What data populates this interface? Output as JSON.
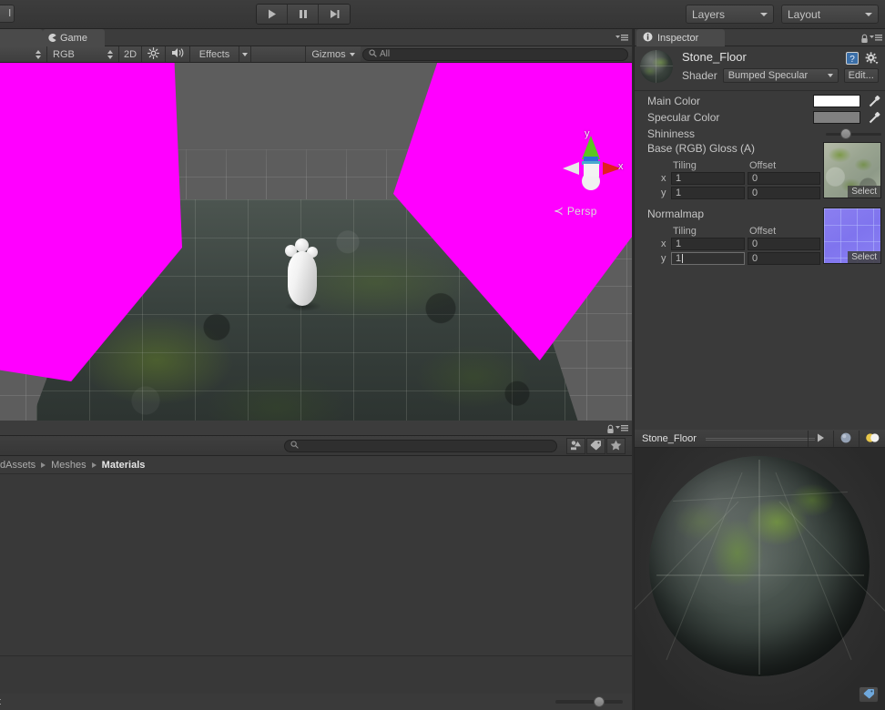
{
  "toolbar": {
    "left_button_label": "l",
    "play_controls": [
      {
        "name": "play",
        "icon": "play-icon"
      },
      {
        "name": "pause",
        "icon": "pause-icon"
      },
      {
        "name": "step",
        "icon": "step-icon"
      }
    ],
    "layers_label": "Layers",
    "layout_label": "Layout"
  },
  "game_view": {
    "tab_label": "Game",
    "toolbar": {
      "aspect_label": "",
      "color_mode": "RGB",
      "mode_2d": "2D",
      "lighting_icon": "sun-icon",
      "audio_icon": "mute-audio-icon",
      "effects_label": "Effects",
      "gizmos_label": "Gizmos",
      "search_placeholder": "All",
      "search_value": "All"
    },
    "gizmo": {
      "axis_y": "y",
      "axis_x": "x",
      "projection_label": "Persp"
    }
  },
  "project_view": {
    "search_value": "",
    "breadcrumb": [
      {
        "label": "dAssets",
        "current": false
      },
      {
        "label": "Meshes",
        "current": false
      },
      {
        "label": "Materials",
        "current": true
      }
    ],
    "footer_text": "t",
    "zoom_value": 55
  },
  "inspector": {
    "tab_label": "Inspector",
    "material_name": "Stone_Floor",
    "shader_label": "Shader",
    "shader_value": "Bumped Specular",
    "edit_button": "Edit...",
    "properties": [
      {
        "label": "Main Color",
        "type": "color",
        "value": "#ffffff"
      },
      {
        "label": "Specular Color",
        "type": "color",
        "value": "#808080"
      },
      {
        "label": "Shininess",
        "type": "slider",
        "value": 28
      }
    ],
    "textures": [
      {
        "label": "Base (RGB) Gloss (A)",
        "tiling_header": "Tiling",
        "offset_header": "Offset",
        "rows": [
          {
            "axis": "x",
            "tiling": "1",
            "offset": "0"
          },
          {
            "axis": "y",
            "tiling": "1",
            "offset": "0"
          }
        ],
        "select_label": "Select",
        "preview": "stone-texture"
      },
      {
        "label": "Normalmap",
        "tiling_header": "Tiling",
        "offset_header": "Offset",
        "rows": [
          {
            "axis": "x",
            "tiling": "1",
            "offset": "0"
          },
          {
            "axis": "y",
            "tiling": "1",
            "offset": "0",
            "editing": true
          }
        ],
        "select_label": "Select",
        "preview": "normalmap-texture"
      }
    ]
  },
  "preview": {
    "title": "Stone_Floor",
    "buttons": [
      {
        "name": "play-preview",
        "icon": "play-icon"
      },
      {
        "name": "preview-mesh",
        "icon": "sphere-icon"
      },
      {
        "name": "preview-lighting",
        "icon": "lighting-icon"
      }
    ],
    "tag_icon": "tag-icon"
  },
  "colors": {
    "magenta_missing_material": "#ff00ff",
    "panel_bg": "#383838",
    "toolbar_bg": "#3d3d3d",
    "text": "#b4b4b4"
  }
}
